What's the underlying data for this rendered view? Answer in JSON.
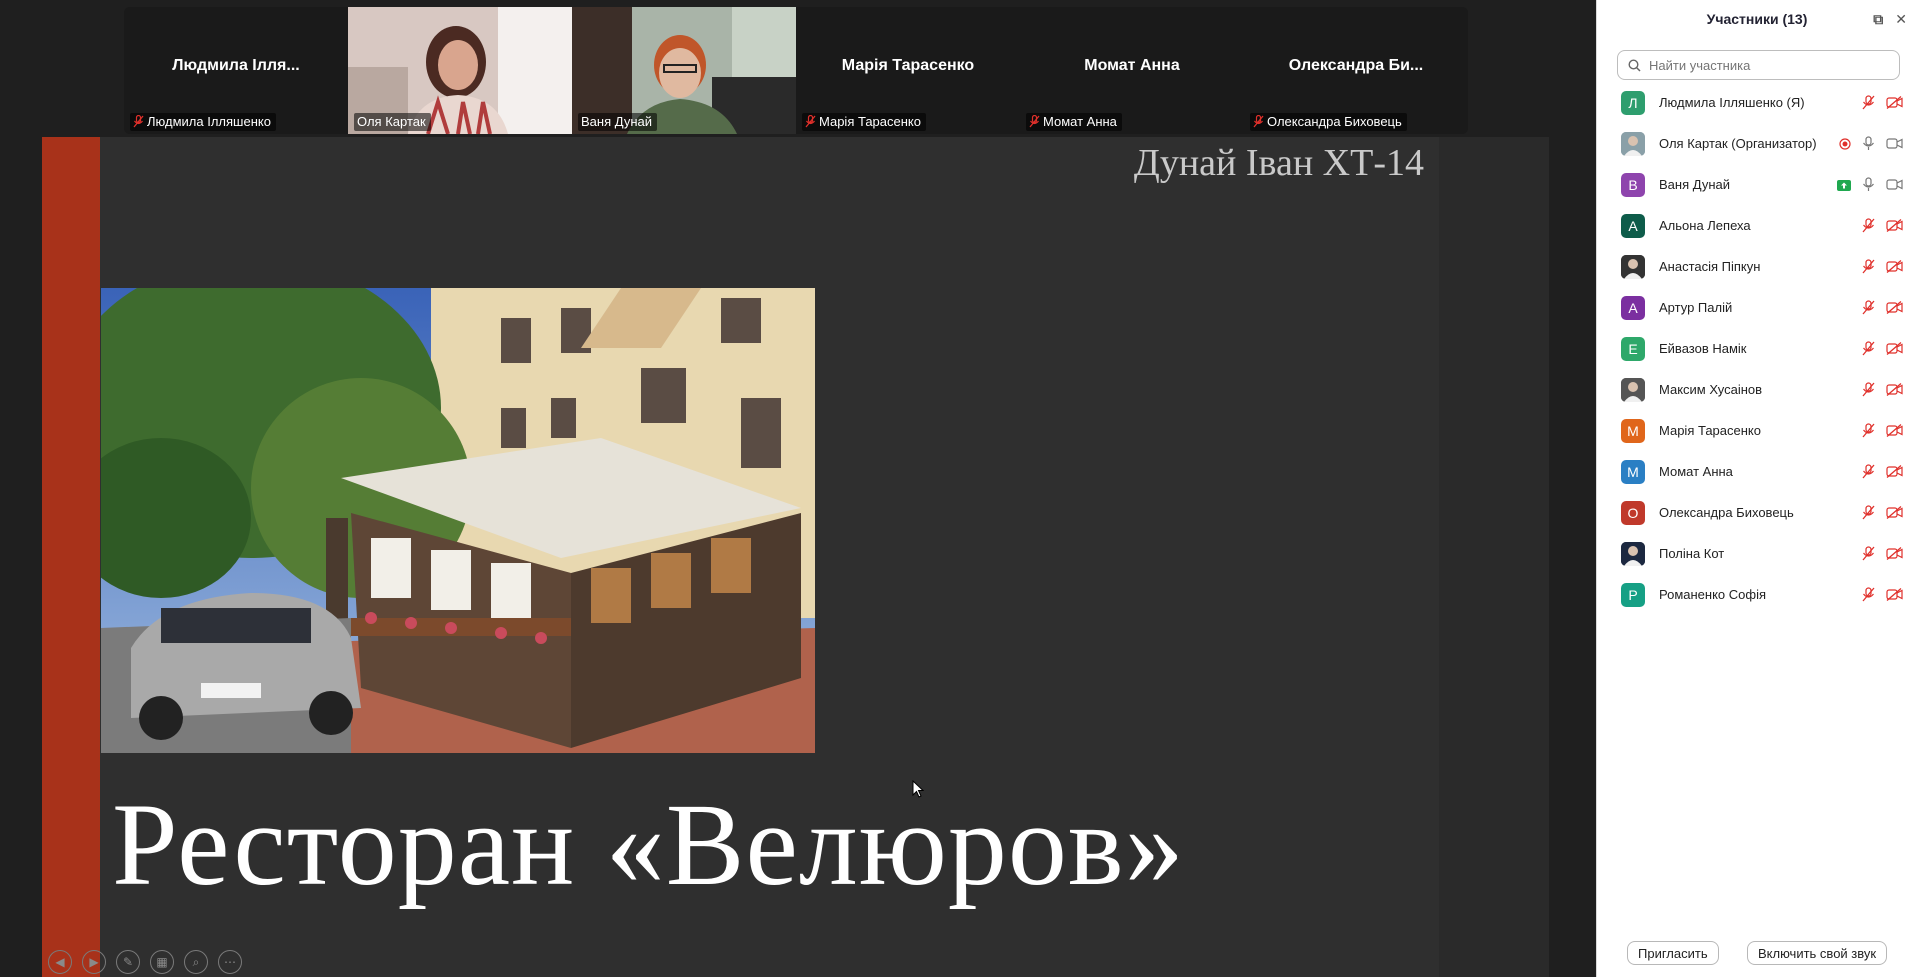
{
  "gallery": {
    "tiles": [
      {
        "center_name": "Людмила Ілля...",
        "label": "Людмила Ілляшенко",
        "muted": true,
        "video": false
      },
      {
        "center_name": "",
        "label": "Оля Картак",
        "muted": false,
        "video": true
      },
      {
        "center_name": "",
        "label": "Ваня Дунай",
        "muted": false,
        "video": true,
        "active": true
      },
      {
        "center_name": "Марія Тарасенко",
        "label": "Марія Тарасенко",
        "muted": true,
        "video": false
      },
      {
        "center_name": "Момат Анна",
        "label": "Момат Анна",
        "muted": true,
        "video": false
      },
      {
        "center_name": "Олександра  Би...",
        "label": "Олександра Биховець",
        "muted": true,
        "video": false
      }
    ]
  },
  "slide": {
    "author": "Дунай Іван ХТ-14",
    "title": "Ресторан «Велюров»"
  },
  "panel": {
    "title": "Участники (13)",
    "search_placeholder": "Найти участника",
    "participants": [
      {
        "initial": "Л",
        "name": "Людмила Ілляшенко (Я)",
        "color": "#2e9e6e",
        "photo": false,
        "mic": "off",
        "cam": "off"
      },
      {
        "initial": "",
        "name": "Оля Картак (Организатор)",
        "color": "#8aa0a8",
        "photo": true,
        "mic": "on",
        "cam": "on",
        "rec": true
      },
      {
        "initial": "B",
        "name": "Ваня Дунай",
        "color": "#8e44ad",
        "photo": false,
        "mic": "on",
        "cam": "on",
        "share": true
      },
      {
        "initial": "А",
        "name": "Альона Лепеха",
        "color": "#0e5c4a",
        "photo": false,
        "mic": "off",
        "cam": "off"
      },
      {
        "initial": "",
        "name": "Анастасія Піпкун",
        "color": "#333333",
        "photo": true,
        "mic": "off",
        "cam": "off"
      },
      {
        "initial": "А",
        "name": "Артур Палій",
        "color": "#7b2fa0",
        "photo": false,
        "mic": "off",
        "cam": "off"
      },
      {
        "initial": "Е",
        "name": "Ейвазов Намік",
        "color": "#2ea86a",
        "photo": false,
        "mic": "off",
        "cam": "off"
      },
      {
        "initial": "",
        "name": "Максим Хусаінов",
        "color": "#555555",
        "photo": true,
        "mic": "off",
        "cam": "off"
      },
      {
        "initial": "М",
        "name": "Марія Тарасенко",
        "color": "#e0661b",
        "photo": false,
        "mic": "off",
        "cam": "off"
      },
      {
        "initial": "М",
        "name": "Момат Анна",
        "color": "#2a7fc4",
        "photo": false,
        "mic": "off",
        "cam": "off"
      },
      {
        "initial": "О",
        "name": "Олександра Биховець",
        "color": "#c0392b",
        "photo": false,
        "mic": "off",
        "cam": "off"
      },
      {
        "initial": "",
        "name": "Поліна Кот",
        "color": "#1c2840",
        "photo": true,
        "mic": "off",
        "cam": "off"
      },
      {
        "initial": "Р",
        "name": "Романенко Софія",
        "color": "#16a085",
        "photo": false,
        "mic": "off",
        "cam": "off"
      }
    ],
    "invite_label": "Пригласить",
    "unmute_label": "Включить свой звук"
  },
  "colors": {
    "accent_active": "#2bc78b",
    "slide_red": "#a8321a",
    "muted_red": "#e0302b"
  }
}
